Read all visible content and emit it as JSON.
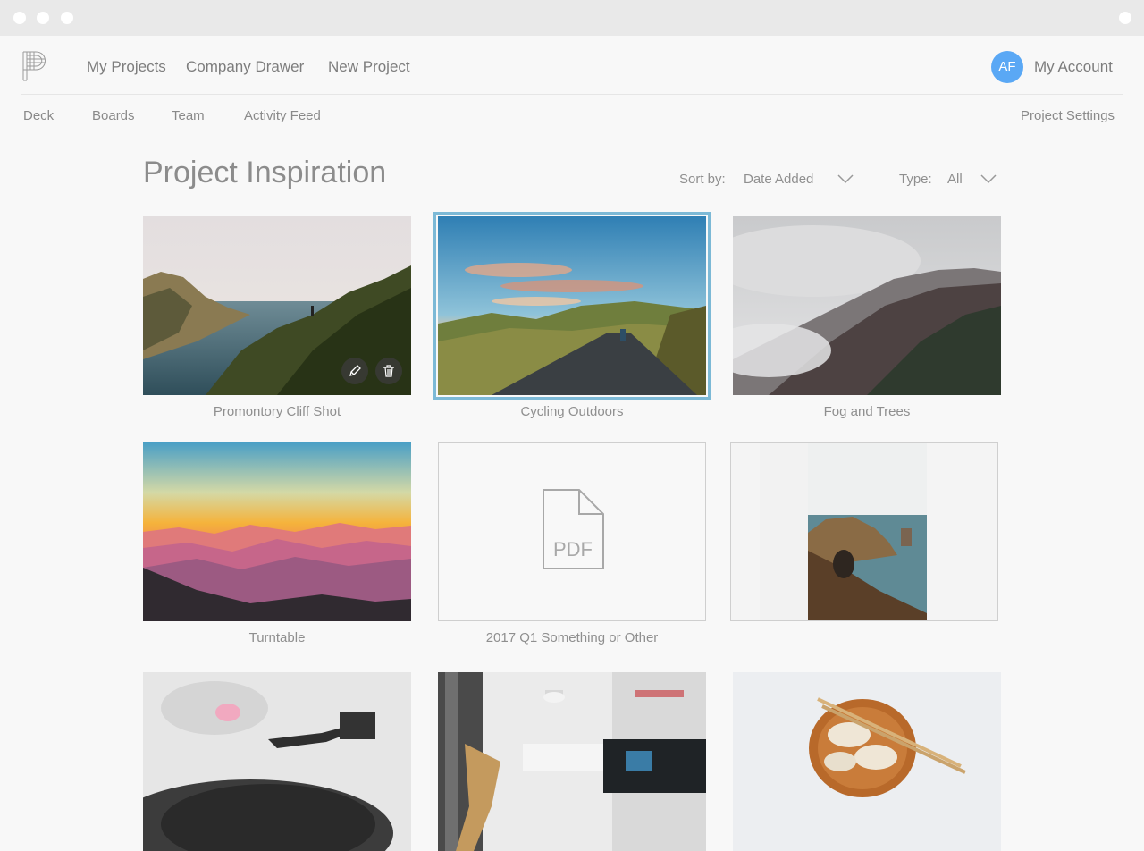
{
  "nav": {
    "links": [
      "My Projects",
      "Company Drawer",
      "New Project"
    ],
    "avatar_initials": "AF",
    "account_label": "My Account"
  },
  "subnav": {
    "tabs": [
      "Deck",
      "Boards",
      "Team",
      "Activity Feed"
    ],
    "settings_label": "Project Settings"
  },
  "page": {
    "title": "Project Inspiration",
    "sort_label": "Sort by:",
    "sort_value": "Date Added",
    "type_label": "Type:",
    "type_value": "All"
  },
  "cards": [
    {
      "caption": "Promontory Cliff Shot",
      "kind": "photo"
    },
    {
      "caption": "Cycling Outdoors",
      "kind": "photo",
      "selected": true
    },
    {
      "caption": "Fog and Trees",
      "kind": "photo"
    },
    {
      "caption": "Turntable",
      "kind": "photo"
    },
    {
      "caption": "2017 Q1 Something or Other",
      "kind": "pdf",
      "file_label": "PDF"
    },
    {
      "caption": "",
      "kind": "photo"
    },
    {
      "caption": "",
      "kind": "photo"
    },
    {
      "caption": "",
      "kind": "photo"
    },
    {
      "caption": "",
      "kind": "photo"
    }
  ],
  "colors": {
    "accent_avatar": "#5aa8f5",
    "selection_outline": "#7cb9d6"
  }
}
